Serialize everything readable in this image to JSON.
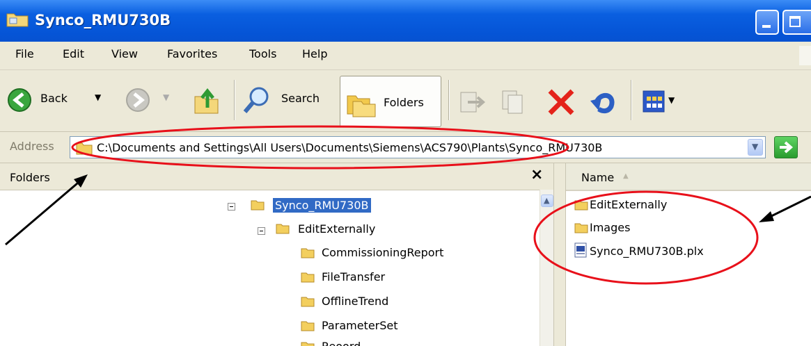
{
  "window": {
    "title": "Synco_RMU730B"
  },
  "menu": [
    "File",
    "Edit",
    "View",
    "Favorites",
    "Tools",
    "Help"
  ],
  "toolbar": {
    "back_label": "Back",
    "search_label": "Search",
    "folders_label": "Folders"
  },
  "address": {
    "label": "Address",
    "path": "C:\\Documents and Settings\\All Users\\Documents\\Siemens\\ACS790\\Plants\\Synco_RMU730B"
  },
  "folders_pane": {
    "title": "Folders",
    "close_glyph": "×",
    "tree": [
      {
        "label": "Synco_RMU730B",
        "level": 0,
        "selected": true
      },
      {
        "label": "EditExternally",
        "level": 1
      },
      {
        "label": "CommissioningReport",
        "level": 2
      },
      {
        "label": "FileTransfer",
        "level": 2
      },
      {
        "label": "OfflineTrend",
        "level": 2
      },
      {
        "label": "ParameterSet",
        "level": 2
      },
      {
        "label": "Reoord",
        "level": 2
      }
    ]
  },
  "files_pane": {
    "name_column": "Name",
    "items": [
      {
        "label": "EditExternally",
        "type": "folder"
      },
      {
        "label": "Images",
        "type": "folder"
      },
      {
        "label": "Synco_RMU730B.plx",
        "type": "file"
      }
    ]
  },
  "colors": {
    "titlebar": "#0a5fe0",
    "chrome": "#ece9d8",
    "selection": "#316ac5",
    "annotation": "#e8101a"
  },
  "icons": [
    "back-arrow-icon",
    "forward-arrow-icon",
    "up-folder-icon",
    "search-icon",
    "folders-icon",
    "move-to-icon",
    "copy-to-icon",
    "delete-icon",
    "undo-icon",
    "views-icon",
    "go-icon"
  ]
}
